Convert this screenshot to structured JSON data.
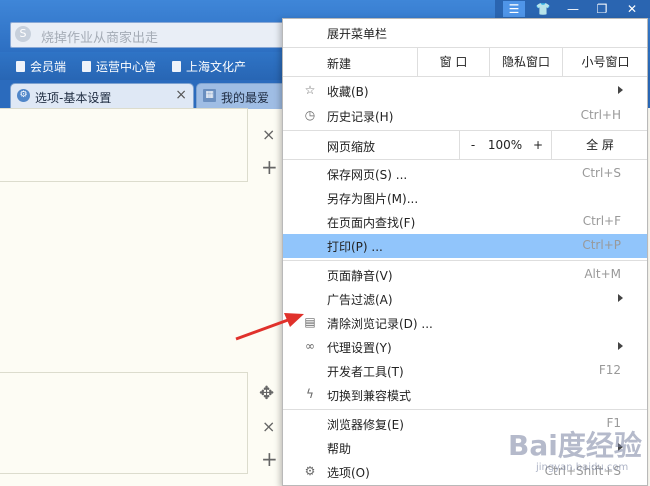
{
  "search": {
    "placeholder": "烧掉作业从商家出走"
  },
  "bookmarks": [
    "会员端",
    "运营中心管",
    "上海文化产"
  ],
  "tabs": [
    {
      "label": "选项-基本设置",
      "close": "×"
    },
    {
      "label": "我的最爱"
    }
  ],
  "window_controls": {
    "menu": "☰",
    "skin": "👕",
    "minimize": "—",
    "restore": "❐",
    "close": "✕"
  },
  "page": {
    "close": "×",
    "add": "+",
    "move": "✥"
  },
  "menu": {
    "expand_menubar": "展开菜单栏",
    "new_row": {
      "label": "新建",
      "window": "窗 口",
      "private": "隐私窗口",
      "small": "小号窗口"
    },
    "favorites": "收藏(B)",
    "history": {
      "label": "历史记录(H)",
      "shortcut": "Ctrl+H"
    },
    "zoom_row": {
      "label": "网页缩放",
      "minus": "-",
      "value": "100%",
      "plus": "+",
      "fullscreen": "全 屏"
    },
    "save_page": {
      "label": "保存网页(S) ...",
      "shortcut": "Ctrl+S"
    },
    "save_as_image": {
      "label": "另存为图片(M)..."
    },
    "find": {
      "label": "在页面内查找(F)",
      "shortcut": "Ctrl+F"
    },
    "print": {
      "label": "打印(P) ...",
      "shortcut": "Ctrl+P"
    },
    "mute": {
      "label": "页面静音(V)",
      "shortcut": "Alt+M"
    },
    "adfilter": {
      "label": "广告过滤(A)"
    },
    "clear": {
      "label": "清除浏览记录(D) ..."
    },
    "proxy": {
      "label": "代理设置(Y)"
    },
    "devtools": {
      "label": "开发者工具(T)",
      "shortcut": "F12"
    },
    "compat": {
      "label": "切换到兼容模式"
    },
    "repair": {
      "label": "浏览器修复(E)",
      "shortcut": "F1"
    },
    "help": {
      "label": "帮助"
    },
    "options": {
      "label": "选项(O)",
      "shortcut": "Ctrl+Shift+S"
    }
  },
  "watermark": {
    "main": "Bai度经验",
    "sub": "jingyan.baidu.com"
  },
  "colors": {
    "highlight": "#91c5fb",
    "chrome": "#2d6fc2",
    "arrow": "#e0312b"
  }
}
